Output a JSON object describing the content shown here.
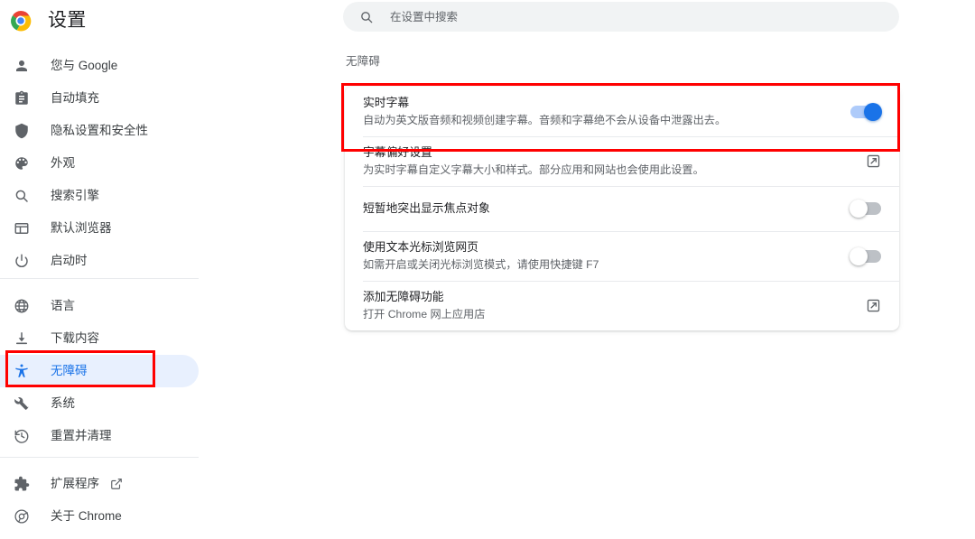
{
  "app": {
    "title": "设置",
    "logo_icon": "chrome-logo-icon"
  },
  "search": {
    "placeholder": "在设置中搜索",
    "value": "",
    "icon": "search-icon"
  },
  "sidebar": {
    "groups": [
      {
        "items": [
          {
            "label": "您与 Google",
            "icon": "person-icon",
            "selected": false
          },
          {
            "label": "自动填充",
            "icon": "clipboard-icon",
            "selected": false
          },
          {
            "label": "隐私设置和安全性",
            "icon": "shield-icon",
            "selected": false
          },
          {
            "label": "外观",
            "icon": "palette-icon",
            "selected": false
          },
          {
            "label": "搜索引擎",
            "icon": "search-icon",
            "selected": false
          },
          {
            "label": "默认浏览器",
            "icon": "browser-window-icon",
            "selected": false
          },
          {
            "label": "启动时",
            "icon": "power-icon",
            "selected": false
          }
        ]
      },
      {
        "items": [
          {
            "label": "语言",
            "icon": "globe-icon",
            "selected": false
          },
          {
            "label": "下载内容",
            "icon": "download-icon",
            "selected": false
          },
          {
            "label": "无障碍",
            "icon": "accessibility-icon",
            "selected": true
          },
          {
            "label": "系统",
            "icon": "wrench-icon",
            "selected": false
          },
          {
            "label": "重置并清理",
            "icon": "restore-icon",
            "selected": false
          }
        ]
      },
      {
        "items": [
          {
            "label": "扩展程序",
            "icon": "puzzle-icon",
            "selected": false,
            "external_link_icon": "external-link-icon"
          },
          {
            "label": "关于 Chrome",
            "icon": "chrome-outline-icon",
            "selected": false
          }
        ]
      }
    ]
  },
  "main": {
    "section_title": "无障碍",
    "rows": [
      {
        "title": "实时字幕",
        "subtitle": "自动为英文版音频和视频创建字幕。音频和字幕绝不会从设备中泄露出去。",
        "control": "toggle",
        "toggle_state": "on"
      },
      {
        "title": "字幕偏好设置",
        "subtitle": "为实时字幕自定义字幕大小和样式。部分应用和网站也会使用此设置。",
        "control": "external-link",
        "control_icon": "external-link-icon"
      },
      {
        "title": "短暂地突出显示焦点对象",
        "subtitle": "",
        "control": "toggle",
        "toggle_state": "off"
      },
      {
        "title": "使用文本光标浏览网页",
        "subtitle": "如需开启或关闭光标浏览模式，请使用快捷键 F7",
        "control": "toggle",
        "toggle_state": "off"
      },
      {
        "title": "添加无障碍功能",
        "subtitle": "打开 Chrome 网上应用店",
        "control": "external-link",
        "control_icon": "external-link-icon"
      }
    ]
  },
  "annotations": [
    {
      "name": "sidebar-accessibility-highlight",
      "color": "#ff0000"
    },
    {
      "name": "live-caption-row-highlight",
      "color": "#ff0000"
    }
  ],
  "colors": {
    "accent": "#1a73e8",
    "accent_light": "#aecbfa",
    "selected_bg": "#e8f0fe",
    "text_primary": "#202124",
    "text_secondary": "#5f6368",
    "divider": "#e8eaed",
    "search_bg": "#f1f3f4",
    "annotation": "#ff0000"
  }
}
